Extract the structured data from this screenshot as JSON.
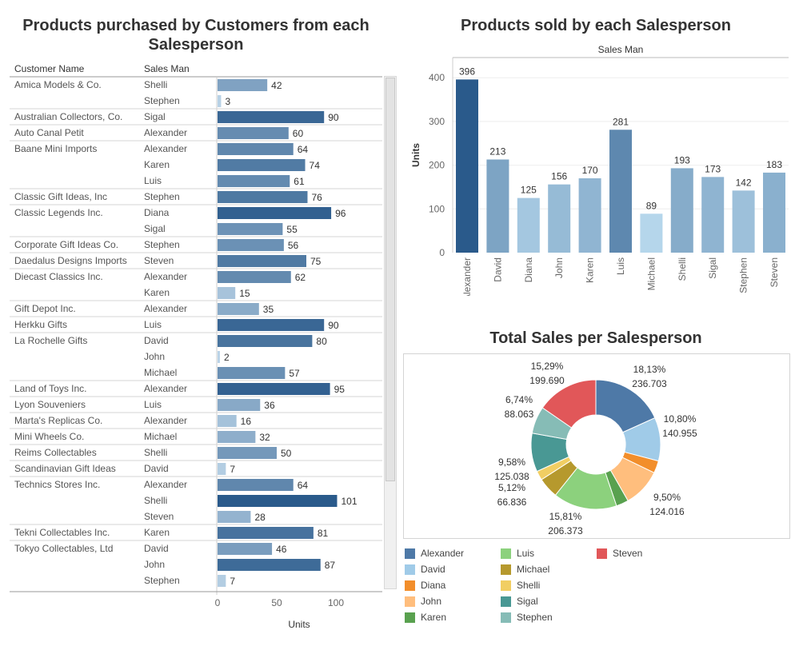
{
  "dashboard": {
    "left_title": "Products purchased by Customers from each Salesperson",
    "right_title": "Products sold by each Salesperson",
    "pie_title": "Total Sales per Salesperson"
  },
  "chart_data": [
    {
      "type": "bar",
      "orientation": "horizontal",
      "title": "Products purchased by Customers from each Salesperson",
      "column_headers": [
        "Customer Name",
        "Sales Man"
      ],
      "xlabel": "Units",
      "xlim": [
        0,
        125
      ],
      "x_ticks": [
        "0",
        "50",
        "100"
      ],
      "rows": [
        {
          "customer": "Amica Models & Co.",
          "salesman": "Shelli",
          "value": 42
        },
        {
          "customer": "",
          "salesman": "Stephen",
          "value": 3
        },
        {
          "customer": "Australian Collectors, Co.",
          "salesman": "Sigal",
          "value": 90
        },
        {
          "customer": "Auto Canal Petit",
          "salesman": "Alexander",
          "value": 60
        },
        {
          "customer": "Baane Mini Imports",
          "salesman": "Alexander",
          "value": 64
        },
        {
          "customer": "",
          "salesman": "Karen",
          "value": 74
        },
        {
          "customer": "",
          "salesman": "Luis",
          "value": 61
        },
        {
          "customer": "Classic Gift Ideas, Inc",
          "salesman": "Stephen",
          "value": 76
        },
        {
          "customer": "Classic Legends Inc.",
          "salesman": "Diana",
          "value": 96
        },
        {
          "customer": "",
          "salesman": "Sigal",
          "value": 55
        },
        {
          "customer": "Corporate Gift Ideas Co.",
          "salesman": "Stephen",
          "value": 56
        },
        {
          "customer": "Daedalus Designs Imports",
          "salesman": "Steven",
          "value": 75
        },
        {
          "customer": "Diecast Classics Inc.",
          "salesman": "Alexander",
          "value": 62
        },
        {
          "customer": "",
          "salesman": "Karen",
          "value": 15
        },
        {
          "customer": "Gift Depot Inc.",
          "salesman": "Alexander",
          "value": 35
        },
        {
          "customer": "Herkku Gifts",
          "salesman": "Luis",
          "value": 90
        },
        {
          "customer": "La Rochelle Gifts",
          "salesman": "David",
          "value": 80
        },
        {
          "customer": "",
          "salesman": "John",
          "value": 2
        },
        {
          "customer": "",
          "salesman": "Michael",
          "value": 57
        },
        {
          "customer": "Land of Toys Inc.",
          "salesman": "Alexander",
          "value": 95
        },
        {
          "customer": "Lyon Souveniers",
          "salesman": "Luis",
          "value": 36
        },
        {
          "customer": "Marta's Replicas Co.",
          "salesman": "Alexander",
          "value": 16
        },
        {
          "customer": "Mini Wheels Co.",
          "salesman": "Michael",
          "value": 32
        },
        {
          "customer": "Reims Collectables",
          "salesman": "Shelli",
          "value": 50
        },
        {
          "customer": "Scandinavian Gift Ideas",
          "salesman": "David",
          "value": 7
        },
        {
          "customer": "Technics Stores Inc.",
          "salesman": "Alexander",
          "value": 64
        },
        {
          "customer": "",
          "salesman": "Shelli",
          "value": 101
        },
        {
          "customer": "",
          "salesman": "Steven",
          "value": 28
        },
        {
          "customer": "Tekni Collectables Inc.",
          "salesman": "Karen",
          "value": 81
        },
        {
          "customer": "Tokyo Collectables, Ltd",
          "salesman": "David",
          "value": 46
        },
        {
          "customer": "",
          "salesman": "John",
          "value": 87
        },
        {
          "customer": "",
          "salesman": "Stephen",
          "value": 7
        }
      ],
      "color_scale": [
        "#cde3f3",
        "#2a5a8b"
      ]
    },
    {
      "type": "bar",
      "title": "Products sold by each Salesperson",
      "header": "Sales Man",
      "ylabel": "Units",
      "ylim": [
        0,
        420
      ],
      "y_ticks": [
        0,
        100,
        200,
        300,
        400
      ],
      "categories": [
        "Alexander",
        "David",
        "Diana",
        "John",
        "Karen",
        "Luis",
        "Michael",
        "Shelli",
        "Sigal",
        "Stephen",
        "Steven"
      ],
      "values": [
        396,
        213,
        125,
        156,
        170,
        281,
        89,
        193,
        173,
        142,
        183
      ],
      "color_scale": [
        "#bcdcf0",
        "#2a5a8b"
      ]
    },
    {
      "type": "pie",
      "style": "donut",
      "title": "Total Sales per Salesperson",
      "slices": [
        {
          "name": "Alexander",
          "value": 236703,
          "pct": "18,13%",
          "label": "236.703",
          "color": "#4e79a7"
        },
        {
          "name": "David",
          "value": 140955,
          "pct": "10,80%",
          "label": "140.955",
          "color": "#a0cbe8"
        },
        {
          "name": "Diana",
          "value": 40000,
          "pct": "",
          "label": "",
          "color": "#f28e2b"
        },
        {
          "name": "John",
          "value": 124016,
          "pct": "9,50%",
          "label": "124.016",
          "color": "#ffbe7d"
        },
        {
          "name": "Karen",
          "value": 40000,
          "pct": "",
          "label": "",
          "color": "#59a14f"
        },
        {
          "name": "Luis",
          "value": 206373,
          "pct": "15,81%",
          "label": "206.373",
          "color": "#8cd17d"
        },
        {
          "name": "Michael",
          "value": 66836,
          "pct": "5,12%",
          "label": "66.836",
          "color": "#b6992d"
        },
        {
          "name": "Shelli",
          "value": 30000,
          "pct": "",
          "label": "",
          "color": "#f1ce63"
        },
        {
          "name": "Sigal",
          "value": 125038,
          "pct": "9,58%",
          "label": "125.038",
          "color": "#499894"
        },
        {
          "name": "Stephen",
          "value": 88063,
          "pct": "6,74%",
          "label": "88.063",
          "color": "#86bcb6"
        },
        {
          "name": "Steven",
          "value": 199690,
          "pct": "15,29%",
          "label": "199.690",
          "color": "#e15759"
        }
      ],
      "legend": [
        {
          "name": "Alexander",
          "color": "#4e79a7"
        },
        {
          "name": "David",
          "color": "#a0cbe8"
        },
        {
          "name": "Diana",
          "color": "#f28e2b"
        },
        {
          "name": "John",
          "color": "#ffbe7d"
        },
        {
          "name": "Karen",
          "color": "#59a14f"
        },
        {
          "name": "Luis",
          "color": "#8cd17d"
        },
        {
          "name": "Michael",
          "color": "#b6992d"
        },
        {
          "name": "Shelli",
          "color": "#f1ce63"
        },
        {
          "name": "Sigal",
          "color": "#499894"
        },
        {
          "name": "Stephen",
          "color": "#86bcb6"
        },
        {
          "name": "Steven",
          "color": "#e15759"
        }
      ]
    }
  ]
}
